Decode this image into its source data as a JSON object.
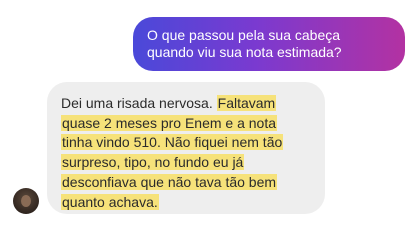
{
  "outgoing_message": {
    "lines": [
      "O que passou pela sua cabeça",
      "quando viu sua nota estimada?"
    ]
  },
  "incoming_message": {
    "lines": [
      {
        "plain": "Dei uma risada nervosa. ",
        "highlight": "Faltavam"
      },
      {
        "plain": "",
        "highlight": "quase 2 meses pro Enem e a nota"
      },
      {
        "plain": "",
        "highlight": "tinha vindo 510. Não fiquei nem tão"
      },
      {
        "plain": "",
        "highlight": "surpreso, tipo, no fundo eu já"
      },
      {
        "plain": "",
        "highlight": "desconfiava que não tava tão bem"
      },
      {
        "plain": "",
        "highlight": "quanto achava."
      }
    ],
    "highlight_color": "#f6e27a"
  },
  "colors": {
    "outgoing_gradient_start": "#4a49d9",
    "outgoing_gradient_end": "#b332a2",
    "incoming_bubble": "#eeeeee"
  },
  "avatar": {
    "icon": "user-avatar-photo"
  }
}
